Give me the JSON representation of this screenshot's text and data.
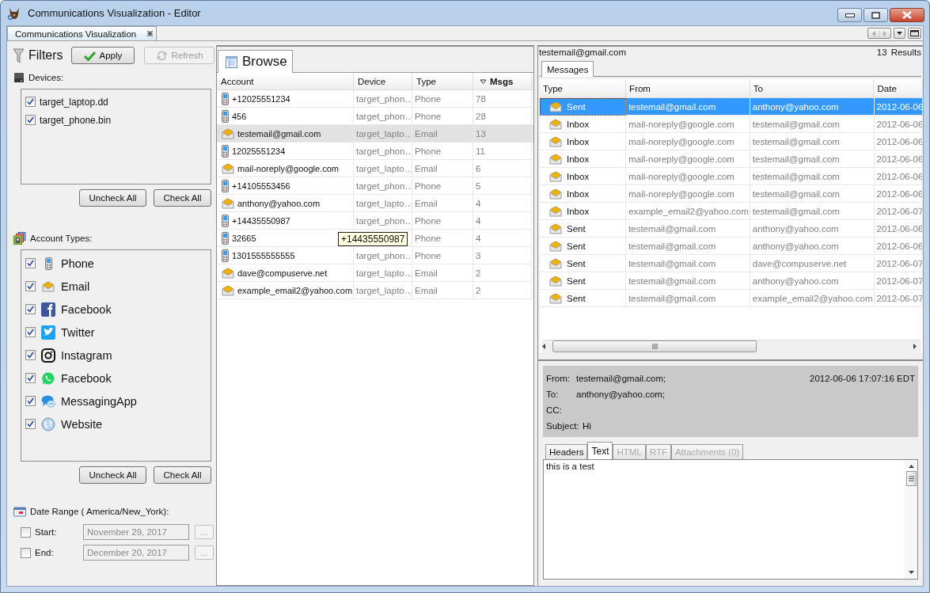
{
  "window": {
    "title": "Communications Visualization - Editor"
  },
  "document_tab": {
    "label": "Communications Visualization",
    "selected": true
  },
  "filters": {
    "title": "Filters",
    "apply_button": "Apply",
    "refresh_button": {
      "label": "Refresh",
      "disabled": true
    },
    "devices": {
      "label": "Devices:",
      "buttons": [
        "Uncheck All",
        "Check All"
      ],
      "items": [
        {
          "label": "target_laptop.dd",
          "checked": true
        },
        {
          "label": "target_phone.bin",
          "checked": true
        }
      ]
    },
    "account_types": {
      "label": "Account Types:",
      "buttons": [
        "Uncheck All",
        "Check All"
      ],
      "items": [
        {
          "label": "Phone",
          "kind": "phone",
          "checked": true
        },
        {
          "label": "Email",
          "kind": "email",
          "checked": true
        },
        {
          "label": "Facebook",
          "kind": "facebook",
          "checked": true
        },
        {
          "label": "Twitter",
          "kind": "twitter",
          "checked": true
        },
        {
          "label": "Instagram",
          "kind": "instagram",
          "checked": true
        },
        {
          "label": "Facebook",
          "kind": "whatsapp",
          "checked": true
        },
        {
          "label": "MessagingApp",
          "kind": "messaging",
          "checked": true
        },
        {
          "label": "Website",
          "kind": "website",
          "checked": true
        }
      ]
    },
    "date_range": {
      "label": "Date Range ( America/New_York):",
      "fields": [
        {
          "label": "Start:",
          "checked": false,
          "value": "November 29, 2017",
          "disabled": true,
          "button": "..."
        },
        {
          "label": "End:",
          "checked": false,
          "value": "December 20, 2017",
          "disabled": true,
          "button": "..."
        }
      ]
    }
  },
  "browse": {
    "tab": {
      "label": "Browse",
      "selected": true
    },
    "columns": [
      {
        "label": "Account",
        "sorted": false
      },
      {
        "label": "Device",
        "sorted": false
      },
      {
        "label": "Type",
        "sorted": false
      },
      {
        "label": "Msgs",
        "sorted": true
      }
    ],
    "rows": [
      {
        "kind": "phone",
        "account": "+12025551234",
        "device": "target_phon…",
        "type": "Phone",
        "msgs": "78",
        "selected": false
      },
      {
        "kind": "phone",
        "account": "456",
        "device": "target_phon…",
        "type": "Phone",
        "msgs": "28",
        "selected": false
      },
      {
        "kind": "email",
        "account": "testemail@gmail.com",
        "device": "target_lapto…",
        "type": "Email",
        "msgs": "13",
        "selected": true
      },
      {
        "kind": "phone",
        "account": "12025551234",
        "device": "target_phon…",
        "type": "Phone",
        "msgs": "11",
        "selected": false
      },
      {
        "kind": "email",
        "account": "mail-noreply@google.com",
        "device": "target_lapto…",
        "type": "Email",
        "msgs": "6",
        "selected": false
      },
      {
        "kind": "phone",
        "account": "+14105553456",
        "device": "target_phon…",
        "type": "Phone",
        "msgs": "5",
        "selected": false
      },
      {
        "kind": "email",
        "account": "anthony@yahoo.com",
        "device": "target_lapto…",
        "type": "Email",
        "msgs": "4",
        "selected": false
      },
      {
        "kind": "phone",
        "account": "+14435550987",
        "device": "target_phon…",
        "type": "Phone",
        "msgs": "4",
        "selected": false
      },
      {
        "kind": "phone",
        "account": "32665",
        "type": "Phone",
        "msgs": "4",
        "selected": false
      },
      {
        "kind": "phone",
        "account": "1301555555555",
        "device": "target_phon…",
        "type": "Phone",
        "msgs": "3",
        "selected": false
      },
      {
        "kind": "email",
        "account": "dave@compuserve.net",
        "device": "target_lapto…",
        "type": "Email",
        "msgs": "2",
        "selected": false
      },
      {
        "kind": "email",
        "account": "example_email2@yahoo.com",
        "device": "target_lapto…",
        "type": "Email",
        "msgs": "2",
        "selected": false
      }
    ],
    "tooltip": "+14435550987"
  },
  "messages": {
    "account": "testemail@gmail.com",
    "count": "13",
    "results_label": "Results",
    "tab": {
      "label": "Messages",
      "selected": true
    },
    "columns": [
      "Type",
      "From",
      "To",
      "Date"
    ],
    "rows": [
      {
        "type": "Sent",
        "from": "testemail@gmail.com",
        "to": "anthony@yahoo.com",
        "date": "2012-06-06",
        "selected": true
      },
      {
        "type": "Inbox",
        "from": "mail-noreply@google.com",
        "to": "testemail@gmail.com",
        "date": "2012-06-06",
        "selected": false
      },
      {
        "type": "Inbox",
        "from": "mail-noreply@google.com",
        "to": "testemail@gmail.com",
        "date": "2012-06-06",
        "selected": false
      },
      {
        "type": "Inbox",
        "from": "mail-noreply@google.com",
        "to": "testemail@gmail.com",
        "date": "2012-06-06",
        "selected": false
      },
      {
        "type": "Inbox",
        "from": "mail-noreply@google.com",
        "to": "testemail@gmail.com",
        "date": "2012-06-06",
        "selected": false
      },
      {
        "type": "Inbox",
        "from": "mail-noreply@google.com",
        "to": "testemail@gmail.com",
        "date": "2012-06-06",
        "selected": false
      },
      {
        "type": "Inbox",
        "from": "example_email2@yahoo.com",
        "to": "testemail@gmail.com",
        "date": "2012-06-07",
        "selected": false
      },
      {
        "type": "Sent",
        "from": "testemail@gmail.com",
        "to": "anthony@yahoo.com",
        "date": "2012-06-06",
        "selected": false
      },
      {
        "type": "Sent",
        "from": "testemail@gmail.com",
        "to": "anthony@yahoo.com",
        "date": "2012-06-06",
        "selected": false
      },
      {
        "type": "Sent",
        "from": "testemail@gmail.com",
        "to": "dave@compuserve.net",
        "date": "2012-06-07",
        "selected": false
      },
      {
        "type": "Sent",
        "from": "testemail@gmail.com",
        "to": "anthony@yahoo.com",
        "date": "2012-06-07",
        "selected": false
      },
      {
        "type": "Sent",
        "from": "testemail@gmail.com",
        "to": "example_email2@yahoo.com",
        "date": "2012-06-07",
        "selected": false
      }
    ]
  },
  "detail": {
    "from_label": "From:",
    "from": "testemail@gmail.com;",
    "date": "2012-06-06 17:07:16 EDT",
    "to_label": "To:",
    "to": "anthony@yahoo.com;",
    "cc_label": "CC:",
    "subject_label": "Subject:",
    "subject": "Hi",
    "tabs": [
      {
        "label": "Headers",
        "selected": false,
        "disabled": false
      },
      {
        "label": "Text",
        "selected": true,
        "disabled": false
      },
      {
        "label": "HTML",
        "selected": false,
        "disabled": true
      },
      {
        "label": "RTF",
        "selected": false,
        "disabled": true
      },
      {
        "label": "Attachments (0)",
        "selected": false,
        "disabled": true
      }
    ],
    "body": "this is a test"
  }
}
